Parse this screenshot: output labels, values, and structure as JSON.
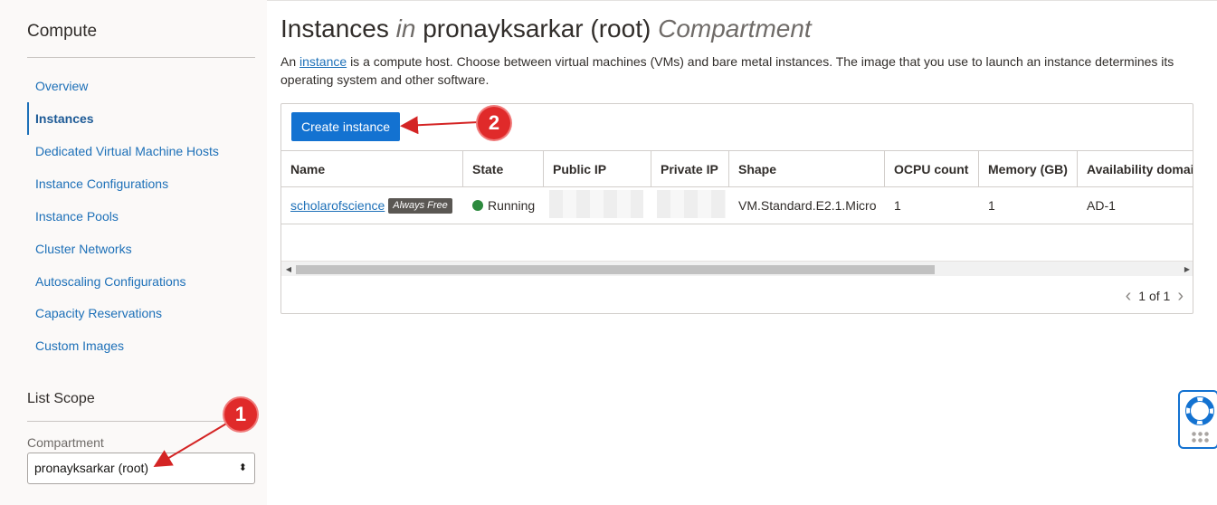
{
  "sidebar": {
    "title": "Compute",
    "items": [
      {
        "label": "Overview"
      },
      {
        "label": "Instances"
      },
      {
        "label": "Dedicated Virtual Machine Hosts"
      },
      {
        "label": "Instance Configurations"
      },
      {
        "label": "Instance Pools"
      },
      {
        "label": "Cluster Networks"
      },
      {
        "label": "Autoscaling Configurations"
      },
      {
        "label": "Capacity Reservations"
      },
      {
        "label": "Custom Images"
      }
    ],
    "active_item": "Instances",
    "scope": {
      "title": "List Scope",
      "compartment_label": "Compartment",
      "compartment_value": "pronayksarkar (root)"
    }
  },
  "header": {
    "title_main": "Instances",
    "title_in": "in",
    "title_compartment_name": "pronayksarkar (root)",
    "title_compartment": "Compartment",
    "desc_prefix": "An",
    "desc_link": "instance",
    "desc_rest": "is a compute host. Choose between virtual machines (VMs) and bare metal instances. The image that you use to launch an instance determines its operating system and other software."
  },
  "toolbar": {
    "create_label": "Create instance"
  },
  "table": {
    "columns": [
      "Name",
      "State",
      "Public IP",
      "Private IP",
      "Shape",
      "OCPU count",
      "Memory (GB)",
      "Availability domai"
    ],
    "rows": [
      {
        "name": "scholarofscience",
        "badge": "Always Free",
        "state": "Running",
        "public_ip": "",
        "private_ip": "",
        "shape": "VM.Standard.E2.1.Micro",
        "ocpu": "1",
        "memory": "1",
        "ad": "AD-1"
      }
    ]
  },
  "pager": {
    "text": "1 of 1"
  },
  "annotations": {
    "callout_1": "1",
    "callout_2": "2"
  },
  "colors": {
    "accent": "#1372d1",
    "link": "#1d70b8",
    "running": "#2d8a3e",
    "annotation": "#e02a2a"
  },
  "icons": {
    "help": "lifebuoy-icon",
    "scroll_left": "triangle-left-icon",
    "scroll_right": "triangle-right-icon"
  }
}
